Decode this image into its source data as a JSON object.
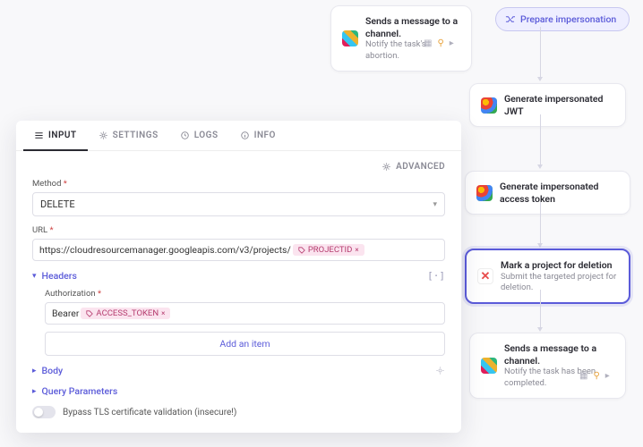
{
  "flow": {
    "top_node": {
      "title": "Sends a message to a channel.",
      "sub": "Notify the task's abortion."
    },
    "pill": {
      "label": "Prepare impersonation"
    },
    "jwt": {
      "title": "Generate impersonated JWT"
    },
    "token": {
      "title": "Generate impersonated access token"
    },
    "mark": {
      "title": "Mark a project for deletion",
      "sub": "Submit the targeted project for deletion."
    },
    "done": {
      "title": "Sends a message to a channel.",
      "sub": "Notify the task has been completed."
    }
  },
  "panel": {
    "tabs": {
      "input": "INPUT",
      "settings": "SETTINGS",
      "logs": "LOGS",
      "info": "INFO"
    },
    "advanced": "ADVANCED",
    "method": {
      "label": "Method",
      "value": "DELETE"
    },
    "url": {
      "label": "URL",
      "prefix": "https://cloudresourcemanager.googleapis.com/v3/projects/",
      "chip": "PROJECTID"
    },
    "headers": {
      "label": "Headers",
      "auth_label": "Authorization",
      "auth_prefix": "Bearer ",
      "auth_chip": "ACCESS_TOKEN",
      "add": "Add an item"
    },
    "body": "Body",
    "query": "Query Parameters",
    "tls": "Bypass TLS certificate validation (insecure!)"
  }
}
